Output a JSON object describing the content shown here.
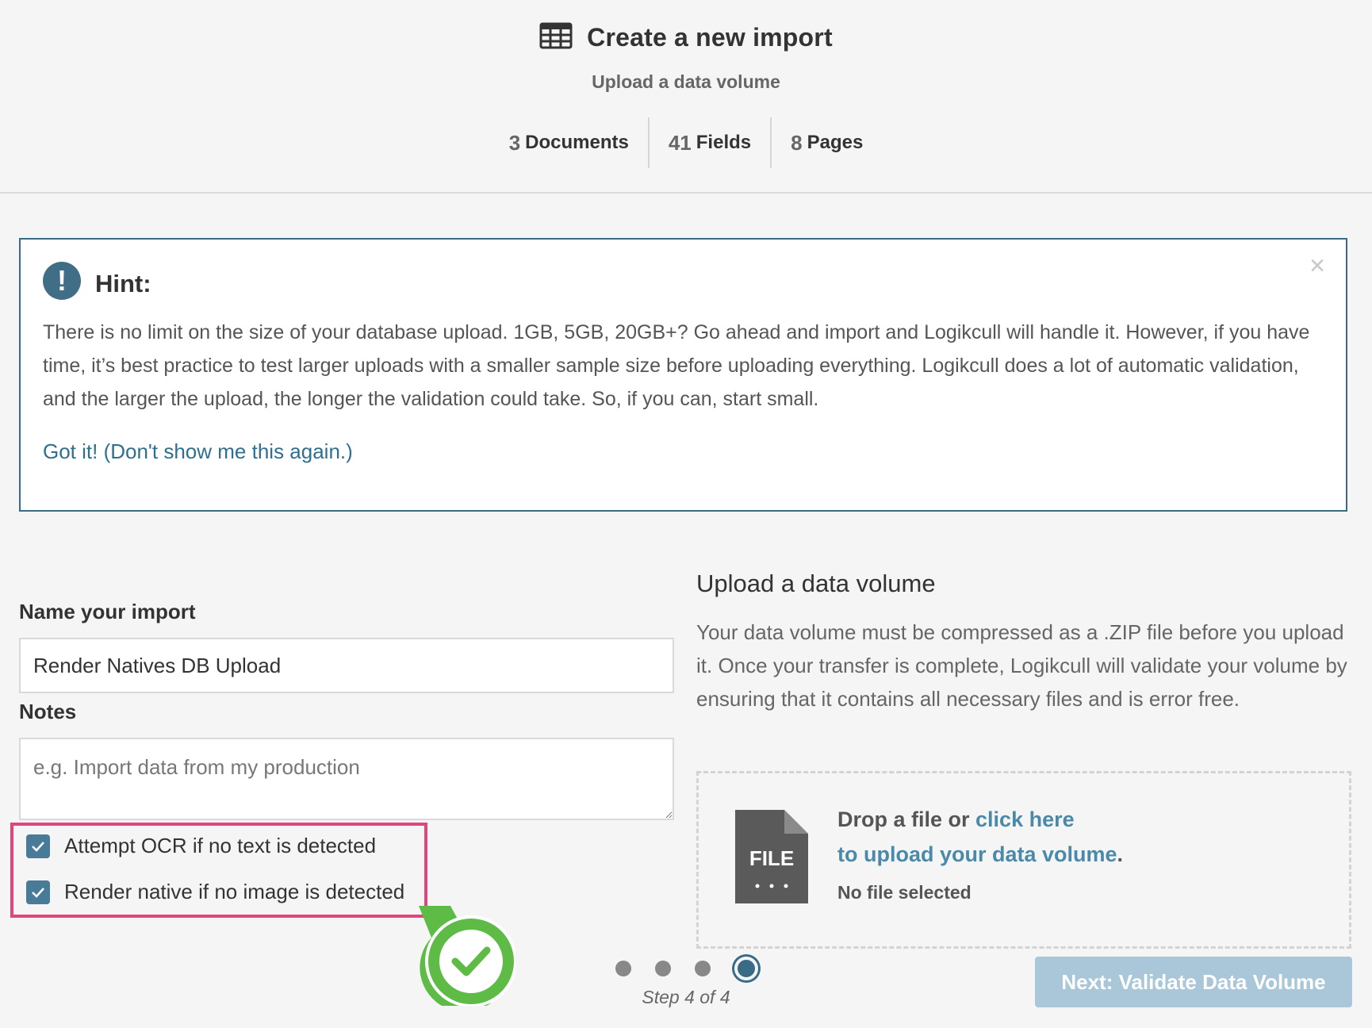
{
  "header": {
    "title": "Create a new import",
    "subtitle": "Upload a data volume",
    "stats": [
      {
        "count": "3",
        "label": "Documents"
      },
      {
        "count": "41",
        "label": "Fields"
      },
      {
        "count": "8",
        "label": "Pages"
      }
    ]
  },
  "hint": {
    "title": "Hint:",
    "icon": "!",
    "close": "×",
    "body": "There is no limit on the size of your database upload. 1GB, 5GB, 20GB+? Go ahead and import and Logikcull will handle it. However, if you have time, it’s best practice to test larger uploads with a smaller sample size before uploading everything. Logikcull does a lot of automatic validation, and the larger the upload, the longer the validation could take. So, if you can, start small.",
    "dismiss_link": "Got it! (Don't show me this again.)"
  },
  "form": {
    "name_label": "Name your import",
    "name_value": "Render Natives DB Upload",
    "notes_label": "Notes",
    "notes_placeholder": "e.g. Import data from my production",
    "options": [
      {
        "label": "Attempt OCR if no text is detected",
        "checked": true
      },
      {
        "label": "Render native if no image is detected",
        "checked": true
      }
    ]
  },
  "upload": {
    "title": "Upload a data volume",
    "description": "Your data volume must be compressed as a .ZIP file before you upload it. Once your transfer is complete, Logikcull will validate your volume by ensuring that it contains all necessary files and is error free.",
    "file_icon_text": "FILE",
    "drop_prefix": "Drop a file or ",
    "drop_link": "click here",
    "drop_link2": "to upload your data volume",
    "drop_suffix": ".",
    "status": "No file selected"
  },
  "footer": {
    "step_label": "Step 4 of 4",
    "total_steps": 4,
    "current_step": 4,
    "next_button": "Next: Validate Data Volume"
  },
  "colors": {
    "accent": "#3f6e86",
    "link": "#2f6f8f",
    "highlight_border": "#e0457b",
    "success": "#5dbb46",
    "button_disabled": "#a9c7d8"
  },
  "icons": {
    "title_icon": "table-icon",
    "hint_icon": "exclamation-icon",
    "checkbox_icon": "checkmark-icon",
    "file_icon": "file-icon",
    "badge_icon": "success-check-icon"
  }
}
